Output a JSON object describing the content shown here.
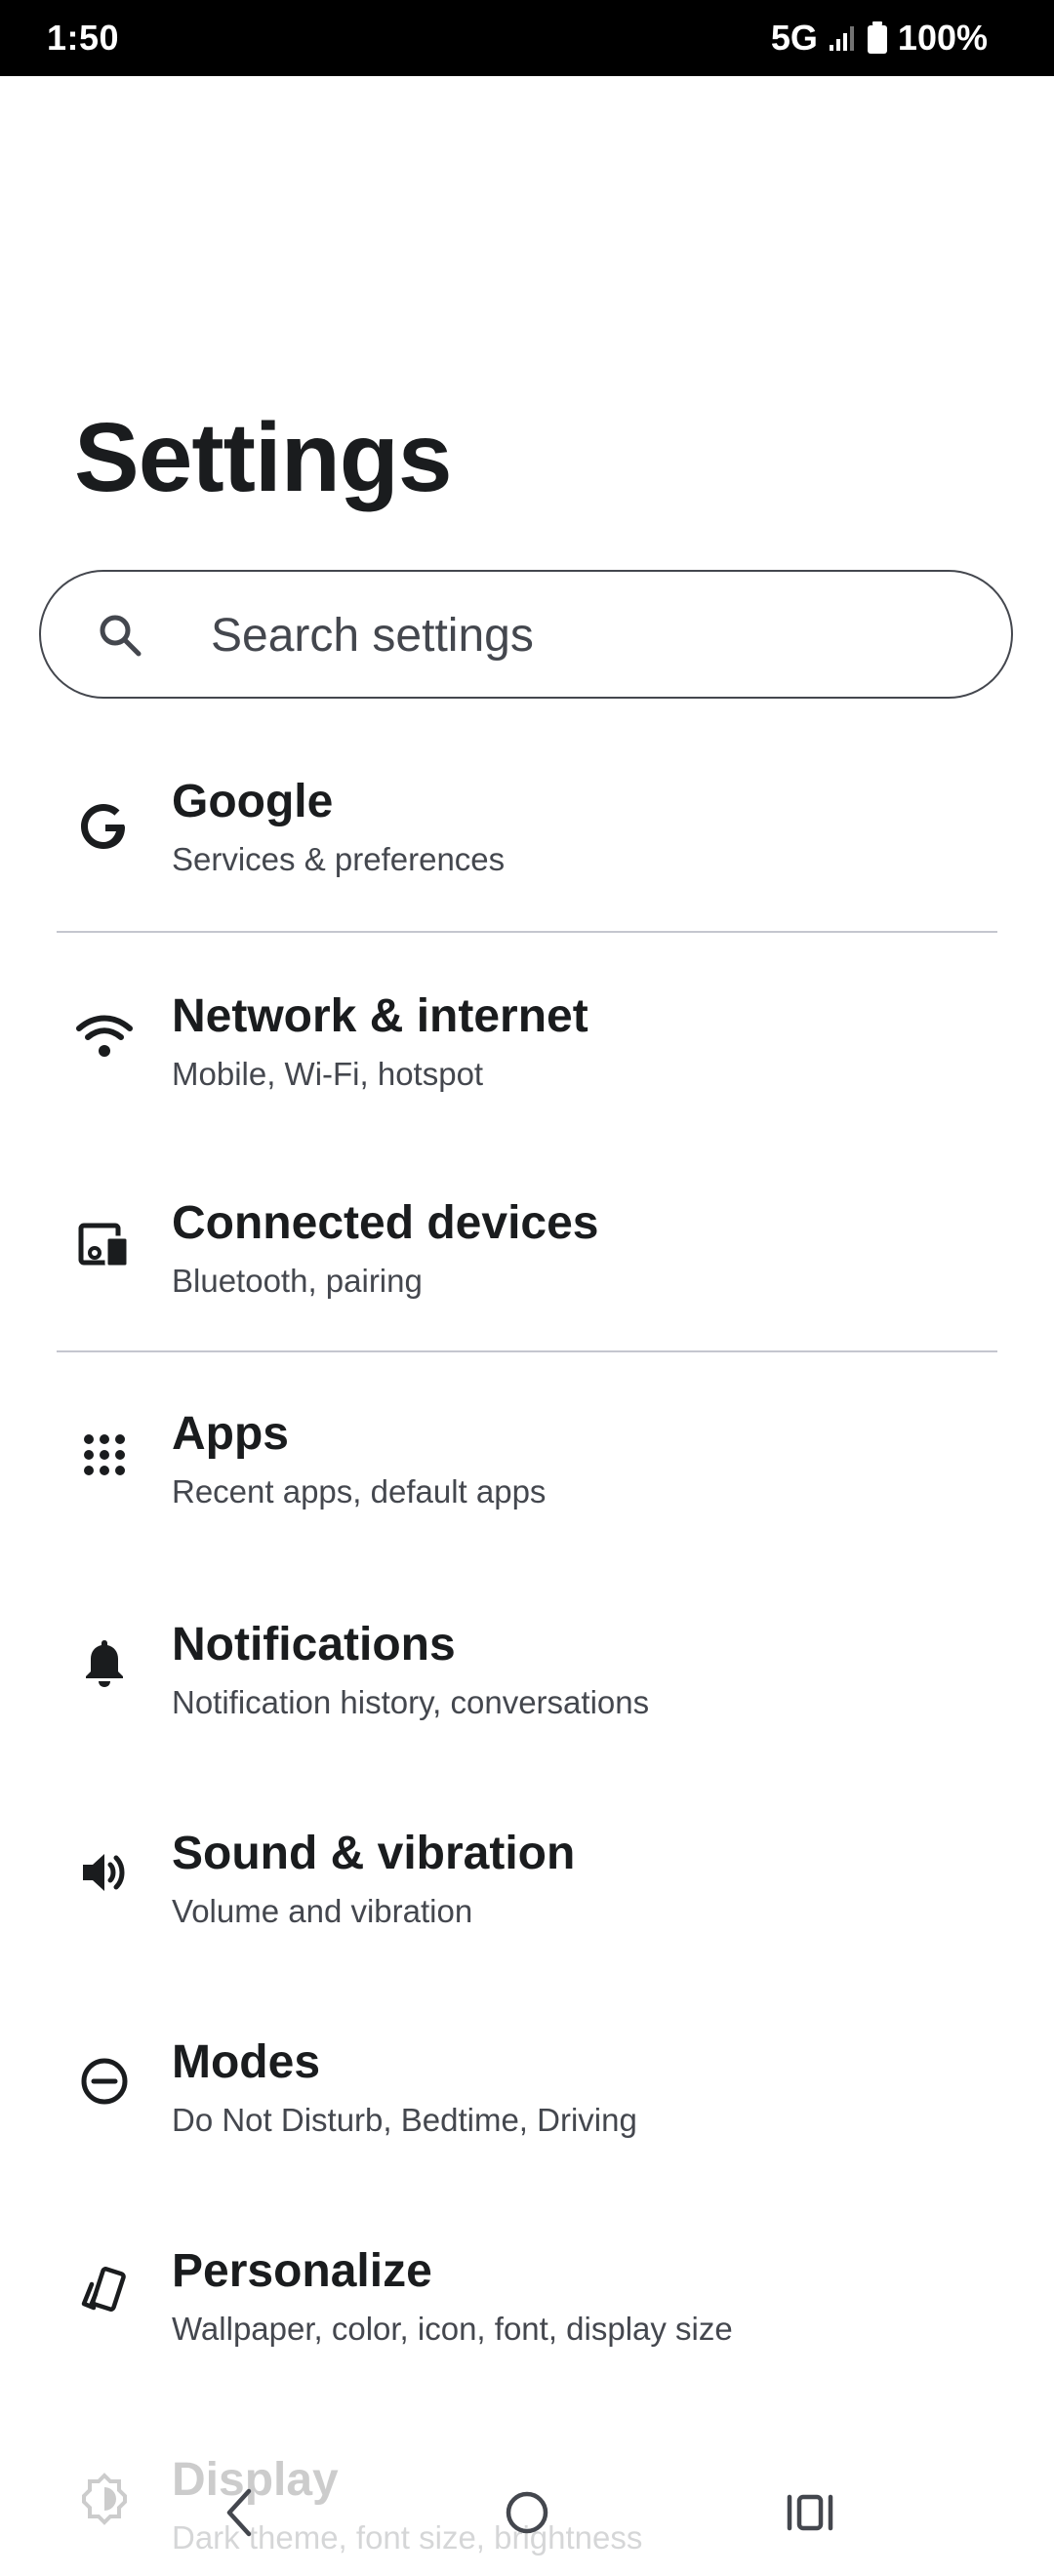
{
  "status_bar": {
    "time": "1:50",
    "network": "5G",
    "battery": "100%"
  },
  "page": {
    "title": "Settings"
  },
  "search": {
    "placeholder": "Search settings"
  },
  "items": [
    {
      "title": "Google",
      "subtitle": "Services & preferences",
      "icon": "google-icon"
    },
    {
      "title": "Network & internet",
      "subtitle": "Mobile, Wi-Fi, hotspot",
      "icon": "wifi-icon"
    },
    {
      "title": "Connected devices",
      "subtitle": "Bluetooth, pairing",
      "icon": "devices-icon"
    },
    {
      "title": "Apps",
      "subtitle": "Recent apps, default apps",
      "icon": "apps-grid-icon"
    },
    {
      "title": "Notifications",
      "subtitle": "Notification history, conversations",
      "icon": "bell-icon"
    },
    {
      "title": "Sound & vibration",
      "subtitle": "Volume and vibration",
      "icon": "speaker-icon"
    },
    {
      "title": "Modes",
      "subtitle": "Do Not Disturb, Bedtime, Driving",
      "icon": "minus-circle-icon"
    },
    {
      "title": "Personalize",
      "subtitle": "Wallpaper, color, icon, font, display size",
      "icon": "personalize-icon"
    },
    {
      "title": "Display",
      "subtitle": "Dark theme, font size, brightness",
      "icon": "brightness-icon"
    }
  ],
  "nav_bar": {
    "buttons": [
      "back",
      "home",
      "recents"
    ]
  }
}
